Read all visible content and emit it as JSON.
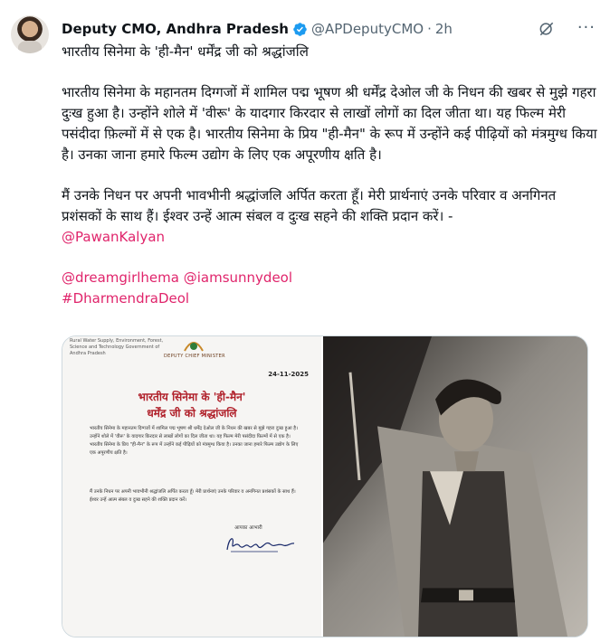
{
  "author": {
    "name": "Deputy CMO, Andhra Pradesh",
    "handle": "@APDeputyCMO",
    "separator": "·",
    "time": "2h"
  },
  "post": {
    "title_line": "भारतीय सिनेमा के 'ही-मैन' धर्मेंद्र जी को श्रद्धांजलि",
    "para1": "भारतीय सिनेमा के महानतम दिग्गजों में शामिल पद्म भूषण श्री धर्मेंद्र देओल जी के निधन की खबर से मुझे गहरा दुःख हुआ है। उन्होंने शोले में 'वीरू' के यादगार किरदार से लाखों लोगों का दिल जीता था। यह फिल्म मेरी पसंदीदा फ़िल्मों में से एक है। भारतीय सिनेमा के प्रिय \"ही-मैन\" के रूप में उन्होंने कई पीढ़ियों को मंत्रमुग्ध किया है। उनका जाना हमारे फिल्म उद्योग के लिए एक अपूरणीय क्षति है।",
    "para2": "मैं उनके निधन पर अपनी भावभीनी श्रद्धांजलि अर्पित करता हूँ। मेरी प्रार्थनाएं उनके परिवार व अनगिनत प्रशंसकों के साथ हैं। ईश्वर उन्हें आत्म संबल व दुःख सहने की शक्ति प्रदान करें। -",
    "mention_pawan": "@PawanKalyan",
    "mention_hema": "@dreamgirlhema",
    "mention_sunny": "@iamsunnydeol",
    "hashtag": "#DharmendraDeol"
  },
  "letter": {
    "dept": "Rural Water Supply, Environment, Forest, Science and Technology Government of Andhra Pradesh",
    "office": "DEPUTY CHIEF MINISTER",
    "date": "24-11-2025",
    "title1": "भारतीय सिनेमा के 'ही-मैन'",
    "title2": "धर्मेंद्र जी को श्रद्धांजलि",
    "para1": "भारतीय सिनेमा के महानतम दिग्गजों में शामिल पद्म भूषण श्री धर्मेंद्र देओल जी के निधन की खबर से मुझे गहरा दुःख हुआ है। उन्होंने शोले में 'वीरू' के यादगार किरदार से लाखों लोगों का दिल जीता था। यह फिल्म मेरी पसंदीदा फ़िल्मों में से एक है। भारतीय सिनेमा के प्रिय \"ही-मैन\" के रूप में उन्होंने कई पीढ़ियों को मंत्रमुग्ध किया है। उनका जाना हमारे फिल्म उद्योग के लिए एक अपूरणीय क्षति है।",
    "para2": "मैं उनके निधन पर अपनी भावभीनी श्रद्धांजलि अर्पित करता हूँ। मेरी प्रार्थनाएं उनके परिवार व अनगिनत प्रशंसकों के साथ हैं। ईश्वर उन्हें आत्म संबल व दुःख सहने की शक्ति प्रदान करें।",
    "regards": "आपका आभारी",
    "signature": "Pawan Kalyan"
  },
  "colors": {
    "link": "#e0246b",
    "verified": "#1d9bf0",
    "letter_title": "#b0202a"
  }
}
